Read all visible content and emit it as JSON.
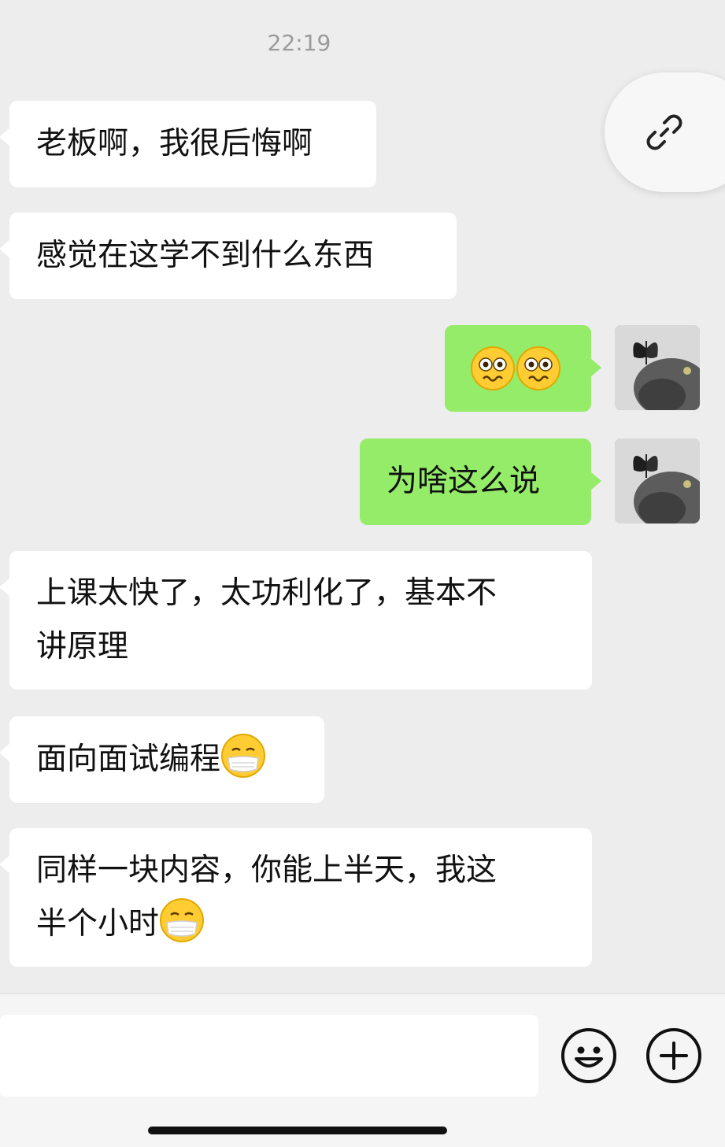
{
  "chat": {
    "timestamp": "22:19",
    "messages": [
      {
        "side": "in",
        "text": "老板啊，我很后悔啊"
      },
      {
        "side": "in",
        "text": "感觉在这学不到什么东西"
      },
      {
        "side": "out",
        "emoji": [
          "woozy-face",
          "woozy-face"
        ]
      },
      {
        "side": "out",
        "text": "为啥这么说"
      },
      {
        "side": "in",
        "lines": [
          "上课太快了，太功利化了，基本不",
          "讲原理"
        ]
      },
      {
        "side": "in",
        "text": "面向面试编程",
        "emoji": "mask-face"
      },
      {
        "side": "in",
        "lines": [
          "同样一块内容，你能上半天，我这",
          "半个小时"
        ],
        "emoji": "mask-face"
      }
    ]
  },
  "floating_button": {
    "icon": "link-icon"
  },
  "input_bar": {
    "input_value": "",
    "emoji_button_icon": "smile-icon",
    "plus_button_icon": "plus-icon"
  },
  "colors": {
    "background": "#ededed",
    "incoming_bubble": "#ffffff",
    "outgoing_bubble": "#95ec69",
    "timestamp": "#9a9a9a"
  }
}
